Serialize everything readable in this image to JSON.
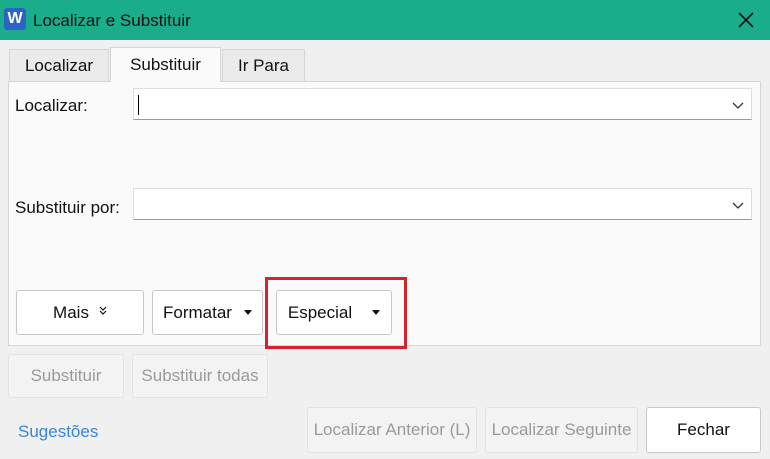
{
  "window": {
    "app_icon_letter": "W",
    "title": "Localizar e Substituir",
    "colors": {
      "titlebar": "#1aad8c",
      "app_icon": "#2b63c9",
      "highlight": "#d6232b",
      "link": "#3a85d8"
    }
  },
  "tabs": [
    {
      "label": "Localizar",
      "active": false
    },
    {
      "label": "Substituir",
      "active": true
    },
    {
      "label": "Ir Para",
      "active": false
    }
  ],
  "find": {
    "label": "Localizar:",
    "value": ""
  },
  "replace": {
    "label": "Substituir por:",
    "value": ""
  },
  "options_buttons": {
    "more": "Mais",
    "format": "Formatar",
    "special": "Especial"
  },
  "actions": {
    "replace": "Substituir",
    "replace_all": "Substituir todas"
  },
  "footer": {
    "suggestions": "Sugestões",
    "find_previous": "Localizar Anterior (L)",
    "find_next": "Localizar Seguinte",
    "close": "Fechar"
  },
  "icons": {
    "close": "close-icon",
    "dropdown": "chevron-down-icon",
    "more": "double-chevron-down-icon",
    "menu_arrow": "triangle-down-icon"
  }
}
